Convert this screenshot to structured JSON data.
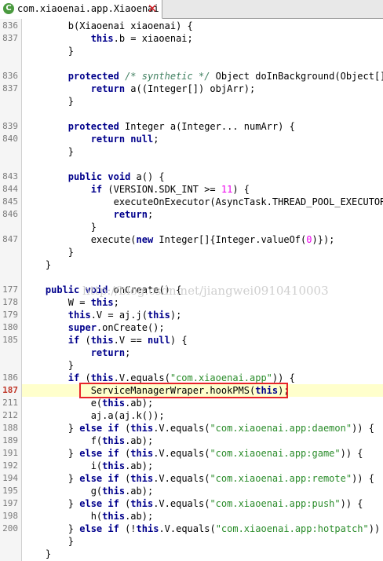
{
  "tab": {
    "icon": "class-file-icon",
    "icon_glyph": "C",
    "title": "com.xiaoenai.app.Xiaoenai",
    "close_glyph": "✕"
  },
  "watermark": "http://blog.csdn.net/jiangwei0910410003",
  "current_line": "187",
  "colors": {
    "keyword": "#00008b",
    "string": "#2a8c2a",
    "number": "#ee00ee",
    "comment": "#3f7f5f",
    "highlight_box": "#e8242a",
    "current_line_bg": "#ffffcc"
  },
  "lines": [
    {
      "num": "836",
      "tokens": [
        [
          "        b(Xiaoenai xiaoenai) {",
          ""
        ]
      ]
    },
    {
      "num": "837",
      "tokens": [
        [
          "            ",
          ""
        ],
        [
          "this",
          "k"
        ],
        [
          ".b = xiaoenai;",
          ""
        ]
      ]
    },
    {
      "num": "",
      "tokens": [
        [
          "        }",
          ""
        ]
      ]
    },
    {
      "num": "",
      "tokens": []
    },
    {
      "num": "836",
      "tokens": [
        [
          "        ",
          ""
        ],
        [
          "protected",
          "k"
        ],
        [
          " ",
          ""
        ],
        [
          "/* synthetic */",
          "c"
        ],
        [
          " Object doInBackground(Object[] o",
          ""
        ]
      ]
    },
    {
      "num": "837",
      "tokens": [
        [
          "            ",
          ""
        ],
        [
          "return",
          "k"
        ],
        [
          " a((Integer[]) objArr);",
          ""
        ]
      ]
    },
    {
      "num": "",
      "tokens": [
        [
          "        }",
          ""
        ]
      ]
    },
    {
      "num": "",
      "tokens": []
    },
    {
      "num": "839",
      "tokens": [
        [
          "        ",
          ""
        ],
        [
          "protected",
          "k"
        ],
        [
          " Integer a(Integer... numArr) {",
          ""
        ]
      ]
    },
    {
      "num": "840",
      "tokens": [
        [
          "            ",
          ""
        ],
        [
          "return",
          "k"
        ],
        [
          " ",
          ""
        ],
        [
          "null",
          "k"
        ],
        [
          ";",
          ""
        ]
      ]
    },
    {
      "num": "",
      "tokens": [
        [
          "        }",
          ""
        ]
      ]
    },
    {
      "num": "",
      "tokens": []
    },
    {
      "num": "843",
      "tokens": [
        [
          "        ",
          ""
        ],
        [
          "public",
          "k"
        ],
        [
          " ",
          ""
        ],
        [
          "void",
          "k"
        ],
        [
          " a() {",
          ""
        ]
      ]
    },
    {
      "num": "844",
      "tokens": [
        [
          "            ",
          ""
        ],
        [
          "if",
          "k"
        ],
        [
          " (VERSION.SDK_INT >= ",
          ""
        ],
        [
          "11",
          "m"
        ],
        [
          ") {",
          ""
        ]
      ]
    },
    {
      "num": "845",
      "tokens": [
        [
          "                executeOnExecutor(AsyncTask.THREAD_POOL_EXECUTOR,",
          ""
        ]
      ]
    },
    {
      "num": "846",
      "tokens": [
        [
          "                ",
          ""
        ],
        [
          "return",
          "k"
        ],
        [
          ";",
          ""
        ]
      ]
    },
    {
      "num": "",
      "tokens": [
        [
          "            }",
          ""
        ]
      ]
    },
    {
      "num": "847",
      "tokens": [
        [
          "            execute(",
          ""
        ],
        [
          "new",
          "k"
        ],
        [
          " Integer[]{Integer.valueOf(",
          ""
        ],
        [
          "0",
          "m"
        ],
        [
          ")});",
          ""
        ]
      ]
    },
    {
      "num": "",
      "tokens": [
        [
          "        }",
          ""
        ]
      ]
    },
    {
      "num": "",
      "tokens": [
        [
          "    }",
          ""
        ]
      ]
    },
    {
      "num": "",
      "tokens": []
    },
    {
      "num": "177",
      "tokens": [
        [
          "    ",
          ""
        ],
        [
          "public",
          "k"
        ],
        [
          " ",
          ""
        ],
        [
          "void",
          "k"
        ],
        [
          " onCreate() {",
          ""
        ]
      ]
    },
    {
      "num": "178",
      "tokens": [
        [
          "        W = ",
          ""
        ],
        [
          "this",
          "k"
        ],
        [
          ";",
          ""
        ]
      ]
    },
    {
      "num": "179",
      "tokens": [
        [
          "        ",
          ""
        ],
        [
          "this",
          "k"
        ],
        [
          ".V = aj.j(",
          ""
        ],
        [
          "this",
          "k"
        ],
        [
          ");",
          ""
        ]
      ]
    },
    {
      "num": "180",
      "tokens": [
        [
          "        ",
          ""
        ],
        [
          "super",
          "k"
        ],
        [
          ".onCreate();",
          ""
        ]
      ]
    },
    {
      "num": "185",
      "tokens": [
        [
          "        ",
          ""
        ],
        [
          "if",
          "k"
        ],
        [
          " (",
          ""
        ],
        [
          "this",
          "k"
        ],
        [
          ".V == ",
          ""
        ],
        [
          "null",
          "k"
        ],
        [
          ") {",
          ""
        ]
      ]
    },
    {
      "num": "",
      "tokens": [
        [
          "            ",
          ""
        ],
        [
          "return",
          "k"
        ],
        [
          ";",
          ""
        ]
      ]
    },
    {
      "num": "",
      "tokens": [
        [
          "        }",
          ""
        ]
      ]
    },
    {
      "num": "186",
      "tokens": [
        [
          "        ",
          ""
        ],
        [
          "if",
          "k"
        ],
        [
          " (",
          ""
        ],
        [
          "this",
          "k"
        ],
        [
          ".V.equals(",
          ""
        ],
        [
          "\"com.xiaoenai.app\"",
          "s"
        ],
        [
          ")) {",
          ""
        ]
      ]
    },
    {
      "num": "187",
      "tokens": [
        [
          "            ServiceManagerWraper.hookPMS(",
          ""
        ],
        [
          "this",
          "k"
        ],
        [
          ");",
          ""
        ]
      ]
    },
    {
      "num": "211",
      "tokens": [
        [
          "            e(",
          ""
        ],
        [
          "this",
          "k"
        ],
        [
          ".ab);",
          ""
        ]
      ]
    },
    {
      "num": "212",
      "tokens": [
        [
          "            aj.a(aj.k());",
          ""
        ]
      ]
    },
    {
      "num": "188",
      "tokens": [
        [
          "        } ",
          ""
        ],
        [
          "else",
          "k"
        ],
        [
          " ",
          ""
        ],
        [
          "if",
          "k"
        ],
        [
          " (",
          ""
        ],
        [
          "this",
          "k"
        ],
        [
          ".V.equals(",
          ""
        ],
        [
          "\"com.xiaoenai.app:daemon\"",
          "s"
        ],
        [
          ")) {",
          ""
        ]
      ]
    },
    {
      "num": "189",
      "tokens": [
        [
          "            f(",
          ""
        ],
        [
          "this",
          "k"
        ],
        [
          ".ab);",
          ""
        ]
      ]
    },
    {
      "num": "191",
      "tokens": [
        [
          "        } ",
          ""
        ],
        [
          "else",
          "k"
        ],
        [
          " ",
          ""
        ],
        [
          "if",
          "k"
        ],
        [
          " (",
          ""
        ],
        [
          "this",
          "k"
        ],
        [
          ".V.equals(",
          ""
        ],
        [
          "\"com.xiaoenai.app:game\"",
          "s"
        ],
        [
          ")) {",
          ""
        ]
      ]
    },
    {
      "num": "192",
      "tokens": [
        [
          "            i(",
          ""
        ],
        [
          "this",
          "k"
        ],
        [
          ".ab);",
          ""
        ]
      ]
    },
    {
      "num": "194",
      "tokens": [
        [
          "        } ",
          ""
        ],
        [
          "else",
          "k"
        ],
        [
          " ",
          ""
        ],
        [
          "if",
          "k"
        ],
        [
          " (",
          ""
        ],
        [
          "this",
          "k"
        ],
        [
          ".V.equals(",
          ""
        ],
        [
          "\"com.xiaoenai.app:remote\"",
          "s"
        ],
        [
          ")) {",
          ""
        ]
      ]
    },
    {
      "num": "195",
      "tokens": [
        [
          "            g(",
          ""
        ],
        [
          "this",
          "k"
        ],
        [
          ".ab);",
          ""
        ]
      ]
    },
    {
      "num": "197",
      "tokens": [
        [
          "        } ",
          ""
        ],
        [
          "else",
          "k"
        ],
        [
          " ",
          ""
        ],
        [
          "if",
          "k"
        ],
        [
          " (",
          ""
        ],
        [
          "this",
          "k"
        ],
        [
          ".V.equals(",
          ""
        ],
        [
          "\"com.xiaoenai.app:push\"",
          "s"
        ],
        [
          ")) {",
          ""
        ]
      ]
    },
    {
      "num": "198",
      "tokens": [
        [
          "            h(",
          ""
        ],
        [
          "this",
          "k"
        ],
        [
          ".ab);",
          ""
        ]
      ]
    },
    {
      "num": "200",
      "tokens": [
        [
          "        } ",
          ""
        ],
        [
          "else",
          "k"
        ],
        [
          " ",
          ""
        ],
        [
          "if",
          "k"
        ],
        [
          " (!",
          ""
        ],
        [
          "this",
          "k"
        ],
        [
          ".V.equals(",
          ""
        ],
        [
          "\"com.xiaoenai.app:hotpatch\"",
          "s"
        ],
        [
          ")) {",
          ""
        ]
      ]
    },
    {
      "num": "",
      "tokens": [
        [
          "        }",
          ""
        ]
      ]
    },
    {
      "num": "",
      "tokens": [
        [
          "    }",
          ""
        ]
      ]
    }
  ]
}
